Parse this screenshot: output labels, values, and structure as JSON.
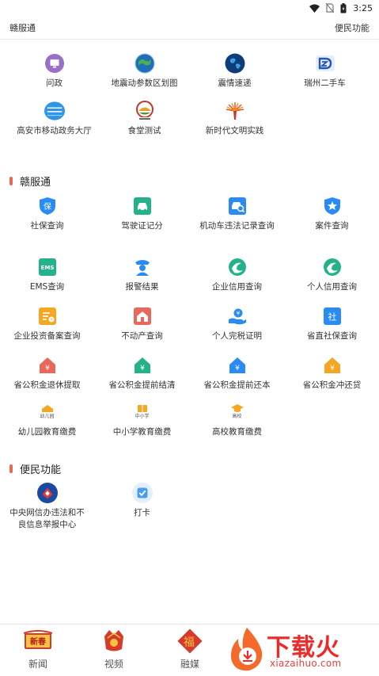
{
  "status_bar": {
    "time": "3:25"
  },
  "header": {
    "left_title": "赣服通",
    "right_title": "便民功能"
  },
  "featured": [
    {
      "label": "问政",
      "icon": "monitor-icon"
    },
    {
      "label": "地震动参数区划图",
      "icon": "globe-map-icon"
    },
    {
      "label": "震情速递",
      "icon": "earth-icon"
    },
    {
      "label": "瑞州二手车",
      "icon": "car-logo-icon"
    },
    {
      "label": "高安市移动政务大厅",
      "icon": "gov-hall-icon"
    },
    {
      "label": "食堂测试",
      "icon": "canteen-icon"
    },
    {
      "label": "新时代文明实践",
      "icon": "torch-icon"
    }
  ],
  "sections": {
    "gfw": {
      "title": "赣服通",
      "items": [
        {
          "label": "社保查询",
          "icon": "shield-bao-icon",
          "color": "#2a8cf2"
        },
        {
          "label": "驾驶证记分",
          "icon": "car-icon",
          "color": "#25b28a"
        },
        {
          "label": "机动车违法记录查询",
          "icon": "car-search-icon",
          "color": "#2a8cf2"
        },
        {
          "label": "案件查询",
          "icon": "badge-star-icon",
          "color": "#2a8cf2"
        },
        {
          "label": "EMS查询",
          "icon": "ems-icon",
          "color": "#25b28a"
        },
        {
          "label": "报警结果",
          "icon": "police-icon",
          "color": "#2a8cf2"
        },
        {
          "label": "企业信用查询",
          "icon": "wave-icon",
          "color": "#25b28a"
        },
        {
          "label": "个人信用查询",
          "icon": "wave-icon",
          "color": "#25b28a"
        },
        {
          "label": "企业投资备案查询",
          "icon": "document-icon",
          "color": "#f5a623"
        },
        {
          "label": "不动产查询",
          "icon": "house-icon",
          "color": "#e8685a"
        },
        {
          "label": "个人完税证明",
          "icon": "hand-coin-icon",
          "color": "#2a8cf2"
        },
        {
          "label": "省直社保查询",
          "icon": "she-icon",
          "color": "#2a8cf2"
        },
        {
          "label": "省公积金退休提取",
          "icon": "house-yen-icon",
          "color": "#e8685a"
        },
        {
          "label": "省公积金提前结清",
          "icon": "house-yen-icon",
          "color": "#25b28a"
        },
        {
          "label": "省公积金提前还本",
          "icon": "house-yen-icon",
          "color": "#2a8cf2"
        },
        {
          "label": "省公积金冲还贷",
          "icon": "house-yen-icon",
          "color": "#f5a623"
        },
        {
          "label": "幼儿园教育缴费",
          "icon": "kindergarten-icon",
          "color": "#f5a623",
          "badge": "幼儿园"
        },
        {
          "label": "中小学教育缴费",
          "icon": "school-icon",
          "color": "#f5a623",
          "badge": "中小学"
        },
        {
          "label": "高校教育缴费",
          "icon": "graduation-cap-icon",
          "color": "#f5a623",
          "badge": "高校"
        }
      ]
    },
    "bm": {
      "title": "便民功能",
      "items": [
        {
          "label": "中央网信办违法和不良信息举报中心",
          "icon": "report-center-icon"
        },
        {
          "label": "打卡",
          "icon": "checkin-icon"
        }
      ]
    }
  },
  "bottom_nav": [
    {
      "label": "新闻",
      "icon": "newspaper-icon",
      "badge": "新春"
    },
    {
      "label": "视频",
      "icon": "video-icon"
    },
    {
      "label": "融媒",
      "icon": "fu-icon",
      "badge": "福"
    }
  ],
  "watermark": {
    "text": "下载火",
    "url": "xiazaihuo.com"
  },
  "colors": {
    "accent_red": "#e8685a",
    "blue": "#2a8cf2",
    "green": "#25b28a",
    "orange": "#f5a623"
  }
}
